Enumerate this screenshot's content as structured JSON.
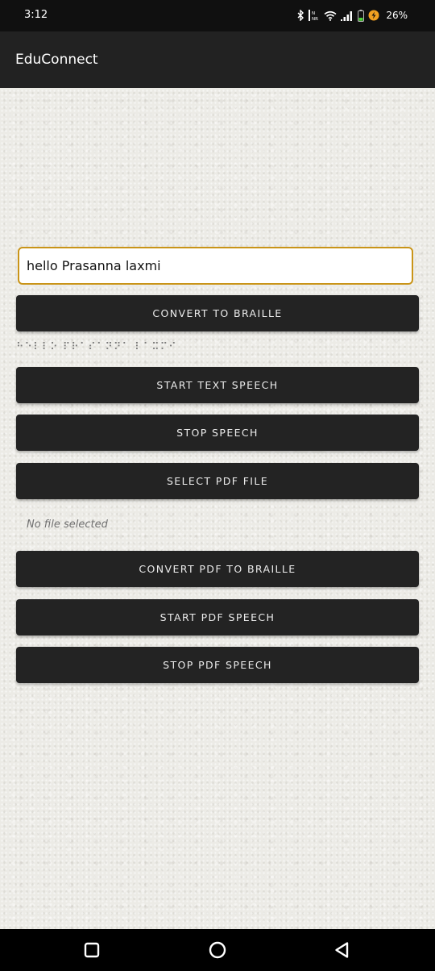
{
  "status_bar": {
    "time": "3:12",
    "battery_percent": "26%",
    "icons": [
      "bluetooth-icon",
      "volte-icon",
      "wifi-icon",
      "signal-icon",
      "battery-icon",
      "battery-saver-icon"
    ]
  },
  "app_bar": {
    "title": "EduConnect",
    "background": "#222222"
  },
  "main": {
    "text_input": {
      "value": "hello Prasanna laxmi",
      "border_color": "#c99418"
    },
    "convert_button": "CONVERT TO BRAILLE",
    "braille_output": "⠓⠑⠇⠇⠕ ⠏⠗⠁⠎⠁⠝⠝⠁ ⠇⠁⠭⠍⠊",
    "start_text_speech_button": "START TEXT SPEECH",
    "stop_speech_button": "STOP SPEECH",
    "select_pdf_button": "SELECT PDF FILE",
    "file_status": "No file selected",
    "convert_pdf_button": "CONVERT PDF TO BRAILLE",
    "start_pdf_speech_button": "START PDF SPEECH",
    "stop_pdf_speech_button": "STOP PDF SPEECH",
    "button_color": "#232323"
  },
  "nav_bar": {
    "icons": [
      "recents-square-icon",
      "home-circle-icon",
      "back-triangle-icon"
    ]
  }
}
